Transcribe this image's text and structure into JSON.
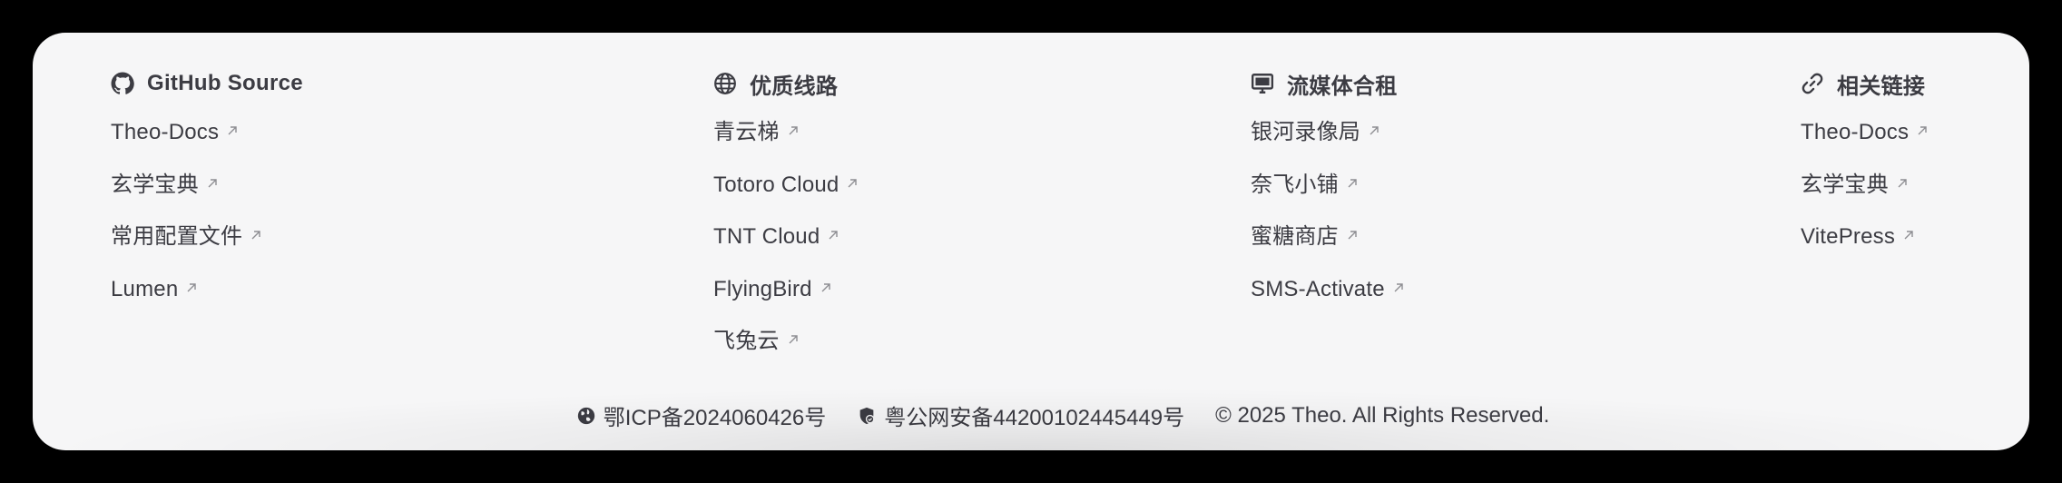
{
  "columns": [
    {
      "title": "GitHub Source",
      "icon": "github-icon",
      "links": [
        "Theo-Docs",
        "玄学宝典",
        "常用配置文件",
        "Lumen"
      ]
    },
    {
      "title": "优质线路",
      "icon": "globe-icon",
      "links": [
        "青云梯",
        "Totoro Cloud",
        "TNT Cloud",
        "FlyingBird",
        "飞兔云"
      ]
    },
    {
      "title": "流媒体合租",
      "icon": "monitor-icon",
      "links": [
        "银河录像局",
        "奈飞小铺",
        "蜜糖商店",
        "SMS-Activate"
      ]
    },
    {
      "title": "相关链接",
      "icon": "link-icon",
      "links": [
        "Theo-Docs",
        "玄学宝典",
        "VitePress"
      ]
    }
  ],
  "footer": {
    "icp": "鄂ICP备2024060426号",
    "police": "粤公网安备44200102445449号",
    "copyright": "© 2025 Theo. All Rights Reserved."
  },
  "colors": {
    "background": "#000000",
    "panel": "#f6f6f7",
    "text": "#3c3c43",
    "arrow": "#8e8e93"
  }
}
